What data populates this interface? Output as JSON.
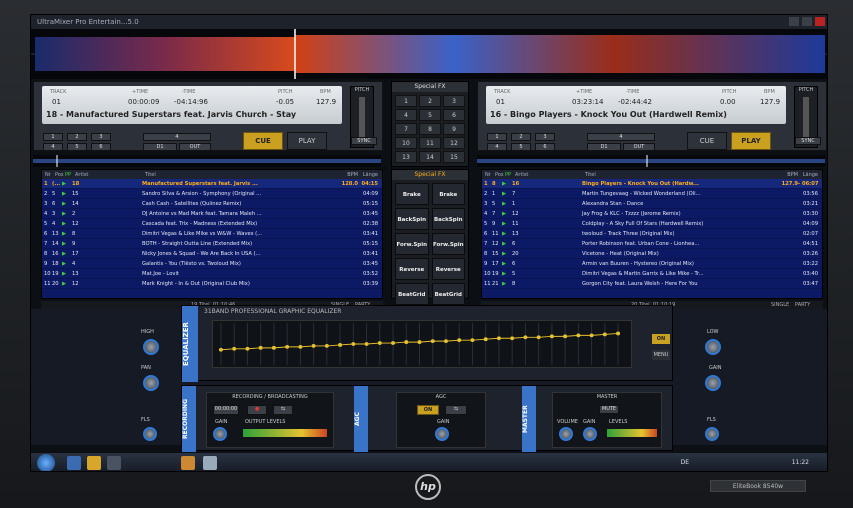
{
  "window": {
    "title": "UltraMixer Pro Entertain...5.0"
  },
  "deckA": {
    "track_label": "TRACK",
    "track": "01",
    "ptime_label": "+TIME",
    "ptime": "00:00:09",
    "mtime_label": "-TIME",
    "mtime": "-04:14:96",
    "pitch_label": "PITCH",
    "pitch": "-0.05",
    "bpm_label": "BPM",
    "bpm": "127.9",
    "title": "18 - Manufactured Superstars feat. Jarvis Church - Stay",
    "cue": "CUE",
    "play": "PLAY",
    "sync": "SYNC",
    "pitch_ctl": "PITCH",
    "keys": [
      "1",
      "2",
      "3",
      "4",
      "5",
      "6",
      "D1",
      "OUT",
      "4"
    ]
  },
  "deckB": {
    "track_label": "TRACK",
    "track": "01",
    "ptime_label": "+TIME",
    "ptime": "03:23:14",
    "mtime_label": "-TIME",
    "mtime": "-02:44:42",
    "pitch_label": "PITCH",
    "pitch": "0.00",
    "bpm_label": "BPM",
    "bpm": "127.9",
    "title": "16 - Bingo Players - Knock You Out (Hardwell Remix)",
    "cue": "CUE",
    "play": "PLAY",
    "sync": "SYNC",
    "pitch_ctl": "PITCH",
    "keys": [
      "1",
      "2",
      "3",
      "4",
      "5",
      "6",
      "D1",
      "OUT",
      "4"
    ]
  },
  "center": {
    "fx_label": "Special FX",
    "nums": [
      "1",
      "2",
      "3",
      "4",
      "5",
      "6",
      "7",
      "8",
      "9",
      "10",
      "11",
      "12",
      "13",
      "14",
      "15"
    ]
  },
  "fx": {
    "label": "Special FX",
    "buttons": [
      "Brake",
      "Brake",
      "BackSpin",
      "BackSpin",
      "Forw.Spin",
      "Forw.Spin",
      "Reverse",
      "Reverse",
      "BeatGrid",
      "BeatGrid"
    ]
  },
  "playlist_head": {
    "nr": "Nr",
    "pos": "Pos",
    "pp": "PP",
    "artist": "Artist",
    "titel": "Titel",
    "bpm": "BPM",
    "lange": "Länge"
  },
  "playlistA": [
    {
      "nr": "1",
      "pos": "(...",
      "pp": "▶",
      "art": "18",
      "tit": "Manufactured Superstars feat. Jarvis ...",
      "bpm": "128.0",
      "len": "04:15"
    },
    {
      "nr": "2",
      "pos": "5",
      "pp": "▶",
      "art": "15",
      "tit": "Sandro Silva & Arsion - Symphony (Original ...",
      "bpm": "",
      "len": "04:09"
    },
    {
      "nr": "3",
      "pos": "6",
      "pp": "▶",
      "art": "14",
      "tit": "Cash Cash - Satellites (Quiinez Remix)",
      "bpm": "",
      "len": "05:15"
    },
    {
      "nr": "4",
      "pos": "3",
      "pp": "▶",
      "art": "2",
      "tit": "DJ Antoine vs Mad Mark feat. Tamara Maleh ...",
      "bpm": "",
      "len": "03:45"
    },
    {
      "nr": "5",
      "pos": "4",
      "pp": "▶",
      "art": "12",
      "tit": "Cascada feat. Trix - Madness (Extended Mix)",
      "bpm": "",
      "len": "02:38"
    },
    {
      "nr": "6",
      "pos": "13",
      "pp": "▶",
      "art": "8",
      "tit": "Dimitri Vegas & Like Mike vs W&W - Waves (...",
      "bpm": "",
      "len": "03:41"
    },
    {
      "nr": "7",
      "pos": "14",
      "pp": "▶",
      "art": "9",
      "tit": "BOTH - Straight Outta Line (Extended Mix)",
      "bpm": "",
      "len": "05:15"
    },
    {
      "nr": "8",
      "pos": "16",
      "pp": "▶",
      "art": "17",
      "tit": "Nicky Jones & Squad - We Are Back In USA (...",
      "bpm": "",
      "len": "03:41"
    },
    {
      "nr": "9",
      "pos": "18",
      "pp": "▶",
      "art": "4",
      "tit": "Galantis - You (Tiësto vs. Twoloud Mix)",
      "bpm": "",
      "len": "03:45"
    },
    {
      "nr": "10",
      "pos": "19",
      "pp": "▶",
      "art": "13",
      "tit": "Mat.Joe - Lovit",
      "bpm": "",
      "len": "03:52"
    },
    {
      "nr": "11",
      "pos": "20",
      "pp": "▶",
      "art": "12",
      "tit": "Mark Knight - In & Out (Original Club Mix)",
      "bpm": "",
      "len": "03:39"
    }
  ],
  "playlistB": [
    {
      "nr": "1",
      "pos": "8",
      "pp": "▶",
      "art": "16",
      "tit": "Bingo Players - Knock You Out (Hardw...",
      "bpm": "127.9",
      "len": "- 06:07"
    },
    {
      "nr": "2",
      "pos": "1",
      "pp": "▶",
      "art": "7",
      "tit": "Martin Tungevaag - Wicked Wonderland (Oli...",
      "bpm": "",
      "len": "03:56"
    },
    {
      "nr": "3",
      "pos": "5",
      "pp": "▶",
      "art": "1",
      "tit": "Alexandra Stan - Dance",
      "bpm": "",
      "len": "03:21"
    },
    {
      "nr": "4",
      "pos": "7",
      "pp": "▶",
      "art": "12",
      "tit": "Jay Frog & KLC - Tzzzz (Jerome Remix)",
      "bpm": "",
      "len": "03:30"
    },
    {
      "nr": "5",
      "pos": "9",
      "pp": "▶",
      "art": "11",
      "tit": "Coldplay - A Sky Full Of Stars (Hardwell Remix)",
      "bpm": "",
      "len": "04:09"
    },
    {
      "nr": "6",
      "pos": "11",
      "pp": "▶",
      "art": "13",
      "tit": "twoloud - Track Three (Original Mix)",
      "bpm": "",
      "len": "02:07"
    },
    {
      "nr": "7",
      "pos": "12",
      "pp": "▶",
      "art": "6",
      "tit": "Porter Robinson feat. Urban Cone - Lionhea...",
      "bpm": "",
      "len": "04:51"
    },
    {
      "nr": "8",
      "pos": "15",
      "pp": "▶",
      "art": "20",
      "tit": "Vicetone - Heat (Original Mix)",
      "bpm": "",
      "len": "03:26"
    },
    {
      "nr": "9",
      "pos": "17",
      "pp": "▶",
      "art": "6",
      "tit": "Armin van Buuren - Hystereo (Original Mix)",
      "bpm": "",
      "len": "03:22"
    },
    {
      "nr": "10",
      "pos": "19",
      "pp": "▶",
      "art": "5",
      "tit": "Dimitri Vegas & Martin Garrix & Like Mike - Tr...",
      "bpm": "",
      "len": "03:40"
    },
    {
      "nr": "11",
      "pos": "21",
      "pp": "▶",
      "art": "8",
      "tit": "Gorgon City feat. Laura Welsh - Here For You",
      "bpm": "",
      "len": "03:47"
    }
  ],
  "footA": "19 Titel, 01:10:46",
  "footB": "20 Titel, 01:10:19",
  "footsingle": "SINGLE",
  "footparty": "PARTY",
  "eq": {
    "side": "EQUALIZER",
    "title": "31BAND PROFESSIONAL GRAPHIC EQUALIZER",
    "on": "ON",
    "menu": "MENU"
  },
  "rec": {
    "side": "RECORDING",
    "box": "RECORDING / BROADCASTING",
    "time": "00:00:00",
    "gain": "GAIN",
    "levels": "OUTPUT LEVELS"
  },
  "agc": {
    "side": "AGC",
    "box": "AGC",
    "on": "ON",
    "gain": "GAIN"
  },
  "master": {
    "side": "MASTER",
    "box": "MASTER",
    "mute": "MUTE",
    "volume": "VOLUME",
    "gain": "GAIN",
    "levels": "LEVELS"
  },
  "knobs": {
    "high": "HIGH",
    "low": "LOW",
    "pan": "PAN",
    "gain": "GAIN",
    "fls": "FLS",
    "k": "K"
  },
  "taskbar": {
    "lang": "DE",
    "time": "11:22"
  },
  "laptop": {
    "brand": "hp",
    "model": "EliteBook 8540w"
  }
}
